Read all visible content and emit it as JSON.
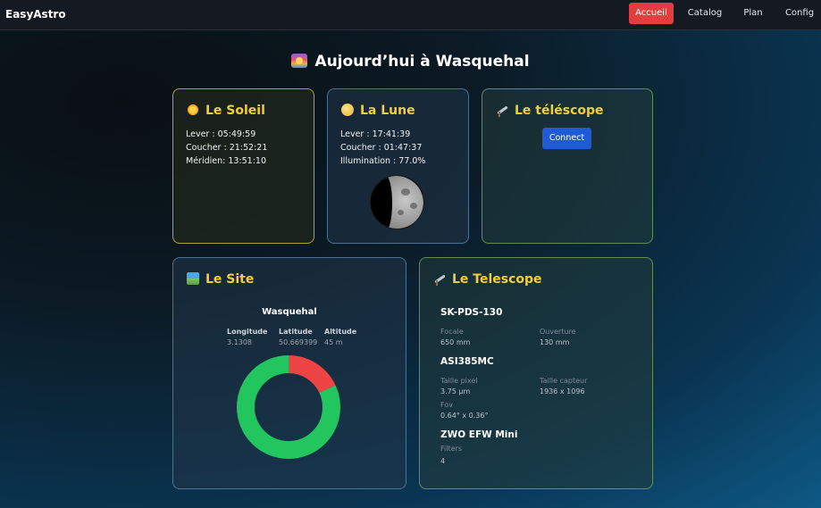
{
  "nav": {
    "brand": "EasyAstro",
    "items": [
      {
        "label": "Accueil",
        "active": true
      },
      {
        "label": "Catalog",
        "active": false
      },
      {
        "label": "Plan",
        "active": false
      },
      {
        "label": "Config",
        "active": false
      }
    ]
  },
  "page": {
    "title": "Aujourd’hui à Wasquehal"
  },
  "sun": {
    "title": "Le Soleil",
    "rise": "Lever : 05:49:59",
    "set": "Coucher : 21:52:21",
    "meridian": "Méridien: 13:51:10"
  },
  "moon": {
    "title": "La Lune",
    "rise": "Lever : 17:41:39",
    "set": "Coucher : 01:47:37",
    "illumination": "Illumination : 77.0%",
    "illumination_value": 0.77
  },
  "telescope_status": {
    "title": "Le téléscope",
    "connect_label": "Connect"
  },
  "site": {
    "title": "Le Site",
    "name": "Wasquehal",
    "longitude_label": "Longitude",
    "longitude": "3.1308",
    "latitude_label": "Latitude",
    "latitude": "50.669399",
    "altitude_label": "Altitude",
    "altitude": "45 m",
    "chart": {
      "segments": [
        {
          "name": "red",
          "fraction": 0.18,
          "color": "#ef4444"
        },
        {
          "name": "green",
          "fraction": 0.82,
          "color": "#22c55e"
        }
      ]
    }
  },
  "telescope": {
    "title": "Le Telescope",
    "scope_name": "SK-PDS-130",
    "focal_label": "Focale",
    "focal": "650 mm",
    "aperture_label": "Ouverture",
    "aperture": "130 mm",
    "camera_name": "ASI385MC",
    "pixel_label": "Taille pixel",
    "pixel": "3.75 µm",
    "sensor_label": "Taille capteur",
    "sensor": "1936 x 1096",
    "fov_label": "Fov",
    "fov": "0.64° x 0.36°",
    "wheel_name": "ZWO EFW Mini",
    "filters_label": "Filters",
    "filters": "4"
  },
  "colors": {
    "accent_yellow": "#f1cf3c",
    "nav_active": "#e23e3e",
    "button_blue": "#1f5bd6",
    "donut_red": "#ef4444",
    "donut_green": "#22c55e"
  }
}
